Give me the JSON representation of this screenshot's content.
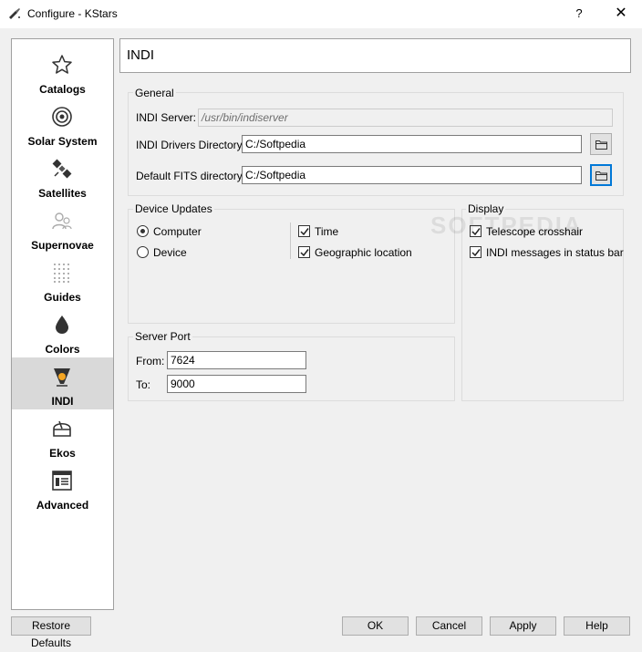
{
  "window": {
    "title": "Configure - KStars",
    "help_glyph": "?",
    "close_glyph": "✕"
  },
  "sidebar": {
    "items": [
      {
        "label": "Catalogs",
        "icon": "star-icon"
      },
      {
        "label": "Solar System",
        "icon": "solar-system-icon"
      },
      {
        "label": "Satellites",
        "icon": "satellite-icon"
      },
      {
        "label": "Supernovae",
        "icon": "supernovae-icon"
      },
      {
        "label": "Guides",
        "icon": "guides-icon"
      },
      {
        "label": "Colors",
        "icon": "colors-icon"
      },
      {
        "label": "INDI",
        "icon": "indi-icon",
        "selected": true
      },
      {
        "label": "Ekos",
        "icon": "ekos-icon"
      },
      {
        "label": "Advanced",
        "icon": "advanced-icon"
      }
    ]
  },
  "header": {
    "title": "INDI"
  },
  "general": {
    "title": "General",
    "server_label": "INDI Server:",
    "server_value": "/usr/bin/indiserver",
    "drivers_label": "INDI Drivers Directory:",
    "drivers_value": "C:/Softpedia",
    "fits_label": "Default FITS directory:",
    "fits_value": "C:/Softpedia"
  },
  "device_updates": {
    "title": "Device Updates",
    "computer_label": "Computer",
    "device_label": "Device",
    "selected": "Computer",
    "time_label": "Time",
    "time_checked": true,
    "geo_label": "Geographic location",
    "geo_checked": true
  },
  "display": {
    "title": "Display",
    "crosshair_label": "Telescope crosshair",
    "crosshair_checked": true,
    "messages_label": "INDI messages in status bar",
    "messages_checked": true
  },
  "server_port": {
    "title": "Server Port",
    "from_label": "From:",
    "from_value": "7624",
    "to_label": "To:",
    "to_value": "9000"
  },
  "buttons": {
    "restore": "Restore Defaults",
    "ok": "OK",
    "cancel": "Cancel",
    "apply": "Apply",
    "help": "Help"
  },
  "watermark": "SOFTPEDIA"
}
